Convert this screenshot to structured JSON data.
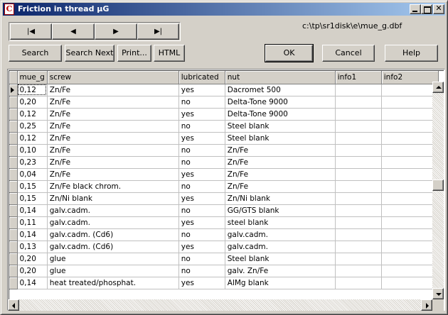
{
  "window": {
    "title": "Friction in thread µG",
    "app_icon_glyph": "C"
  },
  "navigation": {
    "first_glyph": "|◀",
    "prev_glyph": "◀",
    "next_glyph": "▶",
    "last_glyph": "▶|"
  },
  "file_path": "c:\\tp\\sr1disk\\e\\mue_g.dbf",
  "toolbar": {
    "search_label": "Search",
    "search_next_label": "Search Next",
    "print_label": "Print...",
    "html_label": "HTML",
    "ok_label": "OK",
    "cancel_label": "Cancel",
    "help_label": "Help"
  },
  "table": {
    "columns": [
      "mue_g",
      "screw",
      "lubricated",
      "nut",
      "info1",
      "info2"
    ],
    "rows": [
      [
        "0,12",
        "Zn/Fe",
        "yes",
        "Dacromet 500",
        "",
        ""
      ],
      [
        "0,20",
        "Zn/Fe",
        "no",
        "Delta-Tone 9000",
        "",
        ""
      ],
      [
        "0,12",
        "Zn/Fe",
        "yes",
        "Delta-Tone 9000",
        "",
        ""
      ],
      [
        "0,25",
        "Zn/Fe",
        "no",
        "Steel blank",
        "",
        ""
      ],
      [
        "0,12",
        "Zn/Fe",
        "yes",
        "Steel blank",
        "",
        ""
      ],
      [
        "0,10",
        "Zn/Fe",
        "no",
        "Zn/Fe",
        "",
        ""
      ],
      [
        "0,23",
        "Zn/Fe",
        "no",
        "Zn/Fe",
        "",
        ""
      ],
      [
        "0,04",
        "Zn/Fe",
        "yes",
        "Zn/Fe",
        "",
        ""
      ],
      [
        "0,15",
        "Zn/Fe black chrom.",
        "no",
        "Zn/Fe",
        "",
        ""
      ],
      [
        "0,15",
        "Zn/Ni blank",
        "yes",
        "Zn/Ni blank",
        "",
        ""
      ],
      [
        "0,14",
        "galv.cadm.",
        "no",
        "GG/GTS blank",
        "",
        ""
      ],
      [
        "0,11",
        "galv.cadm.",
        "yes",
        "steel blank",
        "",
        ""
      ],
      [
        "0,14",
        "galv.cadm. (Cd6)",
        "no",
        "galv.cadm.",
        "",
        ""
      ],
      [
        "0,13",
        "galv.cadm. (Cd6)",
        "yes",
        "galv.cadm.",
        "",
        ""
      ],
      [
        "0,20",
        "glue",
        "no",
        "Steel blank",
        "",
        ""
      ],
      [
        "0,20",
        "glue",
        "no",
        "galv. Zn/Fe",
        "",
        ""
      ],
      [
        "0,14",
        "heat treated/phosphat.",
        "yes",
        "AlMg blank",
        "",
        ""
      ]
    ],
    "current_row": 0
  },
  "scroll": {
    "vertical_position_fraction": 0.47
  },
  "colors": {
    "title_start": "#0a246a",
    "title_end": "#a6caf0",
    "face": "#d4d0c8"
  }
}
